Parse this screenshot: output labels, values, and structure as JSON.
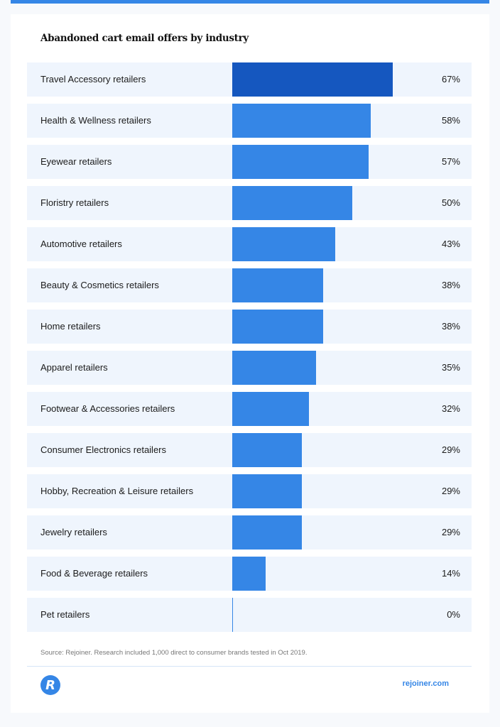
{
  "chart_data": {
    "type": "bar",
    "orientation": "horizontal",
    "title": "Abandoned cart email offers by industry",
    "xlabel": "",
    "ylabel": "",
    "unit": "%",
    "xlim": [
      0,
      100
    ],
    "grid": false,
    "legend": "none",
    "highlight_index": 0,
    "categories": [
      "Travel Accessory retailers",
      "Health & Wellness retailers",
      "Eyewear retailers",
      "Floristry retailers",
      "Automotive retailers",
      "Beauty & Cosmetics retailers",
      "Home retailers",
      "Apparel retailers",
      "Footwear & Accessories retailers",
      "Consumer Electronics retailers",
      "Hobby, Recreation & Leisure retailers",
      "Jewelry retailers",
      "Food & Beverage retailers",
      "Pet retailers"
    ],
    "values": [
      67,
      58,
      57,
      50,
      43,
      38,
      38,
      35,
      32,
      29,
      29,
      29,
      14,
      0
    ],
    "value_labels": [
      "67%",
      "58%",
      "57%",
      "50%",
      "43%",
      "38%",
      "38%",
      "35%",
      "32%",
      "29%",
      "29%",
      "29%",
      "14%",
      "0%"
    ],
    "colors": {
      "highlight": "#1557bf",
      "bar": "#3586e6",
      "row_bg": "#eff5fd"
    }
  },
  "footer": {
    "source": "Source: Rejoiner. Research included 1,000 direct to consumer brands tested in Oct 2019.",
    "logo_letter": "R",
    "site": "rejoiner.com"
  }
}
